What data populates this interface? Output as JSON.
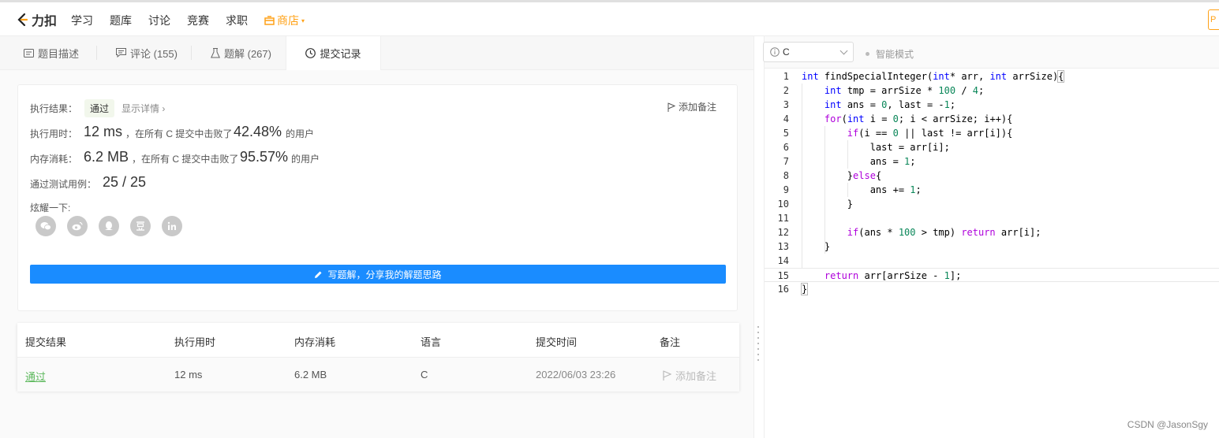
{
  "brand": {
    "name": "力扣",
    "accent": "#ffa116"
  },
  "nav": {
    "items": [
      "学习",
      "题库",
      "讨论",
      "竞赛",
      "求职"
    ],
    "store": "商店"
  },
  "top_right": {
    "label": "P"
  },
  "tabs": [
    {
      "label": "题目描述",
      "icon": "description-icon"
    },
    {
      "label": "评论 (155)",
      "icon": "comment-icon"
    },
    {
      "label": "题解 (267)",
      "icon": "flask-icon"
    },
    {
      "label": "提交记录",
      "icon": "clock-icon"
    }
  ],
  "result": {
    "status_label": "执行结果：",
    "status": "通过",
    "detail_link": "显示详情 ›",
    "add_note": "添加备注",
    "runtime_label": "执行用时：",
    "runtime_value": "12 ms",
    "runtime_mid": "，在所有 C 提交中击败了",
    "runtime_pct": "42.48%",
    "runtime_tail": "的用户",
    "memory_label": "内存消耗：",
    "memory_value": "6.2 MB",
    "memory_mid": "，在所有 C 提交中击败了",
    "memory_pct": "95.57%",
    "memory_tail": "的用户",
    "tests_label": "通过测试用例：",
    "tests_value": "25 / 25",
    "share_label": "炫耀一下:",
    "share_icons": [
      "wechat-icon",
      "weibo-icon",
      "qq-icon",
      "douban-icon",
      "linkedin-icon"
    ],
    "write_button": "写题解，分享我的解题思路"
  },
  "table": {
    "headers": [
      "提交结果",
      "执行用时",
      "内存消耗",
      "语言",
      "提交时间",
      "备注"
    ],
    "rows": [
      {
        "status": "通过",
        "runtime": "12 ms",
        "memory": "6.2 MB",
        "language": "C",
        "time": "2022/06/03 23:26",
        "note": "添加备注"
      }
    ]
  },
  "editor": {
    "language": "C",
    "mode": "智能模式",
    "lines": [
      "int findSpecialInteger(int* arr, int arrSize){",
      "    int tmp = arrSize * 100 / 4;",
      "    int ans = 0, last = -1;",
      "    for(int i = 0; i < arrSize; i++){",
      "        if(i == 0 || last != arr[i]){",
      "            last = arr[i];",
      "            ans = 1;",
      "        }else{",
      "            ans += 1;",
      "        }",
      "",
      "        if(ans * 100 > tmp) return arr[i];",
      "    }",
      "",
      "    return arr[arrSize - 1];",
      "}"
    ]
  },
  "watermark": "CSDN @JasonSgy"
}
